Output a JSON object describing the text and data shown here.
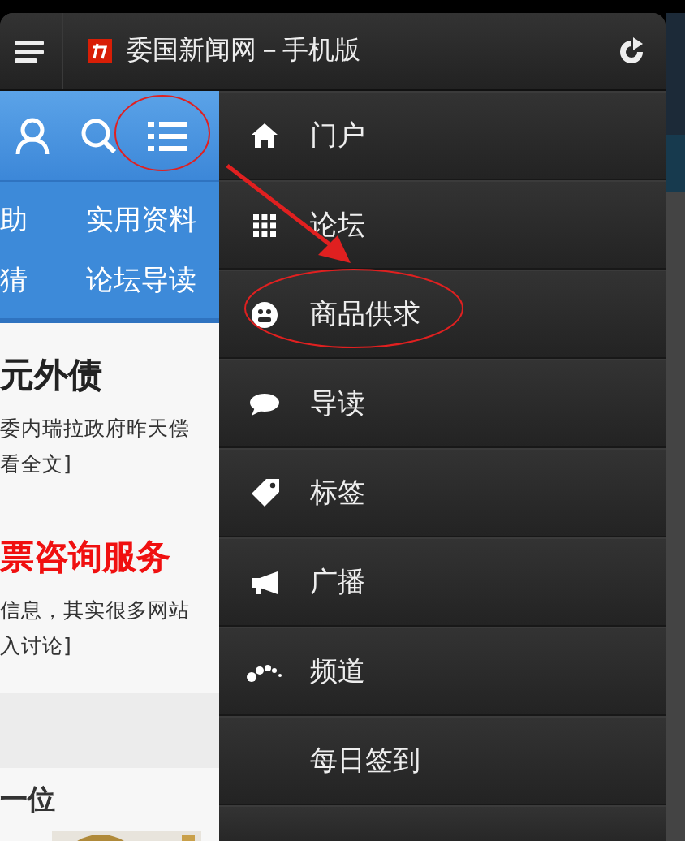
{
  "header": {
    "title": "委国新闻网－手机版"
  },
  "nav_links": [
    [
      "助",
      "实用资料"
    ],
    [
      "猜",
      "论坛导读"
    ]
  ],
  "articles": [
    {
      "kind": "normal",
      "title": "元外债",
      "lines": [
        "委内瑞拉政府昨天偿",
        "看全文]"
      ]
    },
    {
      "kind": "highlight",
      "title": "票咨询服务",
      "lines": [
        "信息，其实很多网站",
        "入讨论]"
      ]
    }
  ],
  "section_heading": "一位",
  "menu": [
    {
      "kind": "home",
      "label": "门户"
    },
    {
      "kind": "grid",
      "label": "论坛"
    },
    {
      "kind": "smile",
      "label": "商品供求"
    },
    {
      "kind": "bubble",
      "label": "导读"
    },
    {
      "kind": "tag",
      "label": "标签"
    },
    {
      "kind": "megaphone",
      "label": "广播"
    },
    {
      "kind": "dots",
      "label": "频道"
    },
    {
      "kind": "plain",
      "label": "每日签到"
    }
  ]
}
